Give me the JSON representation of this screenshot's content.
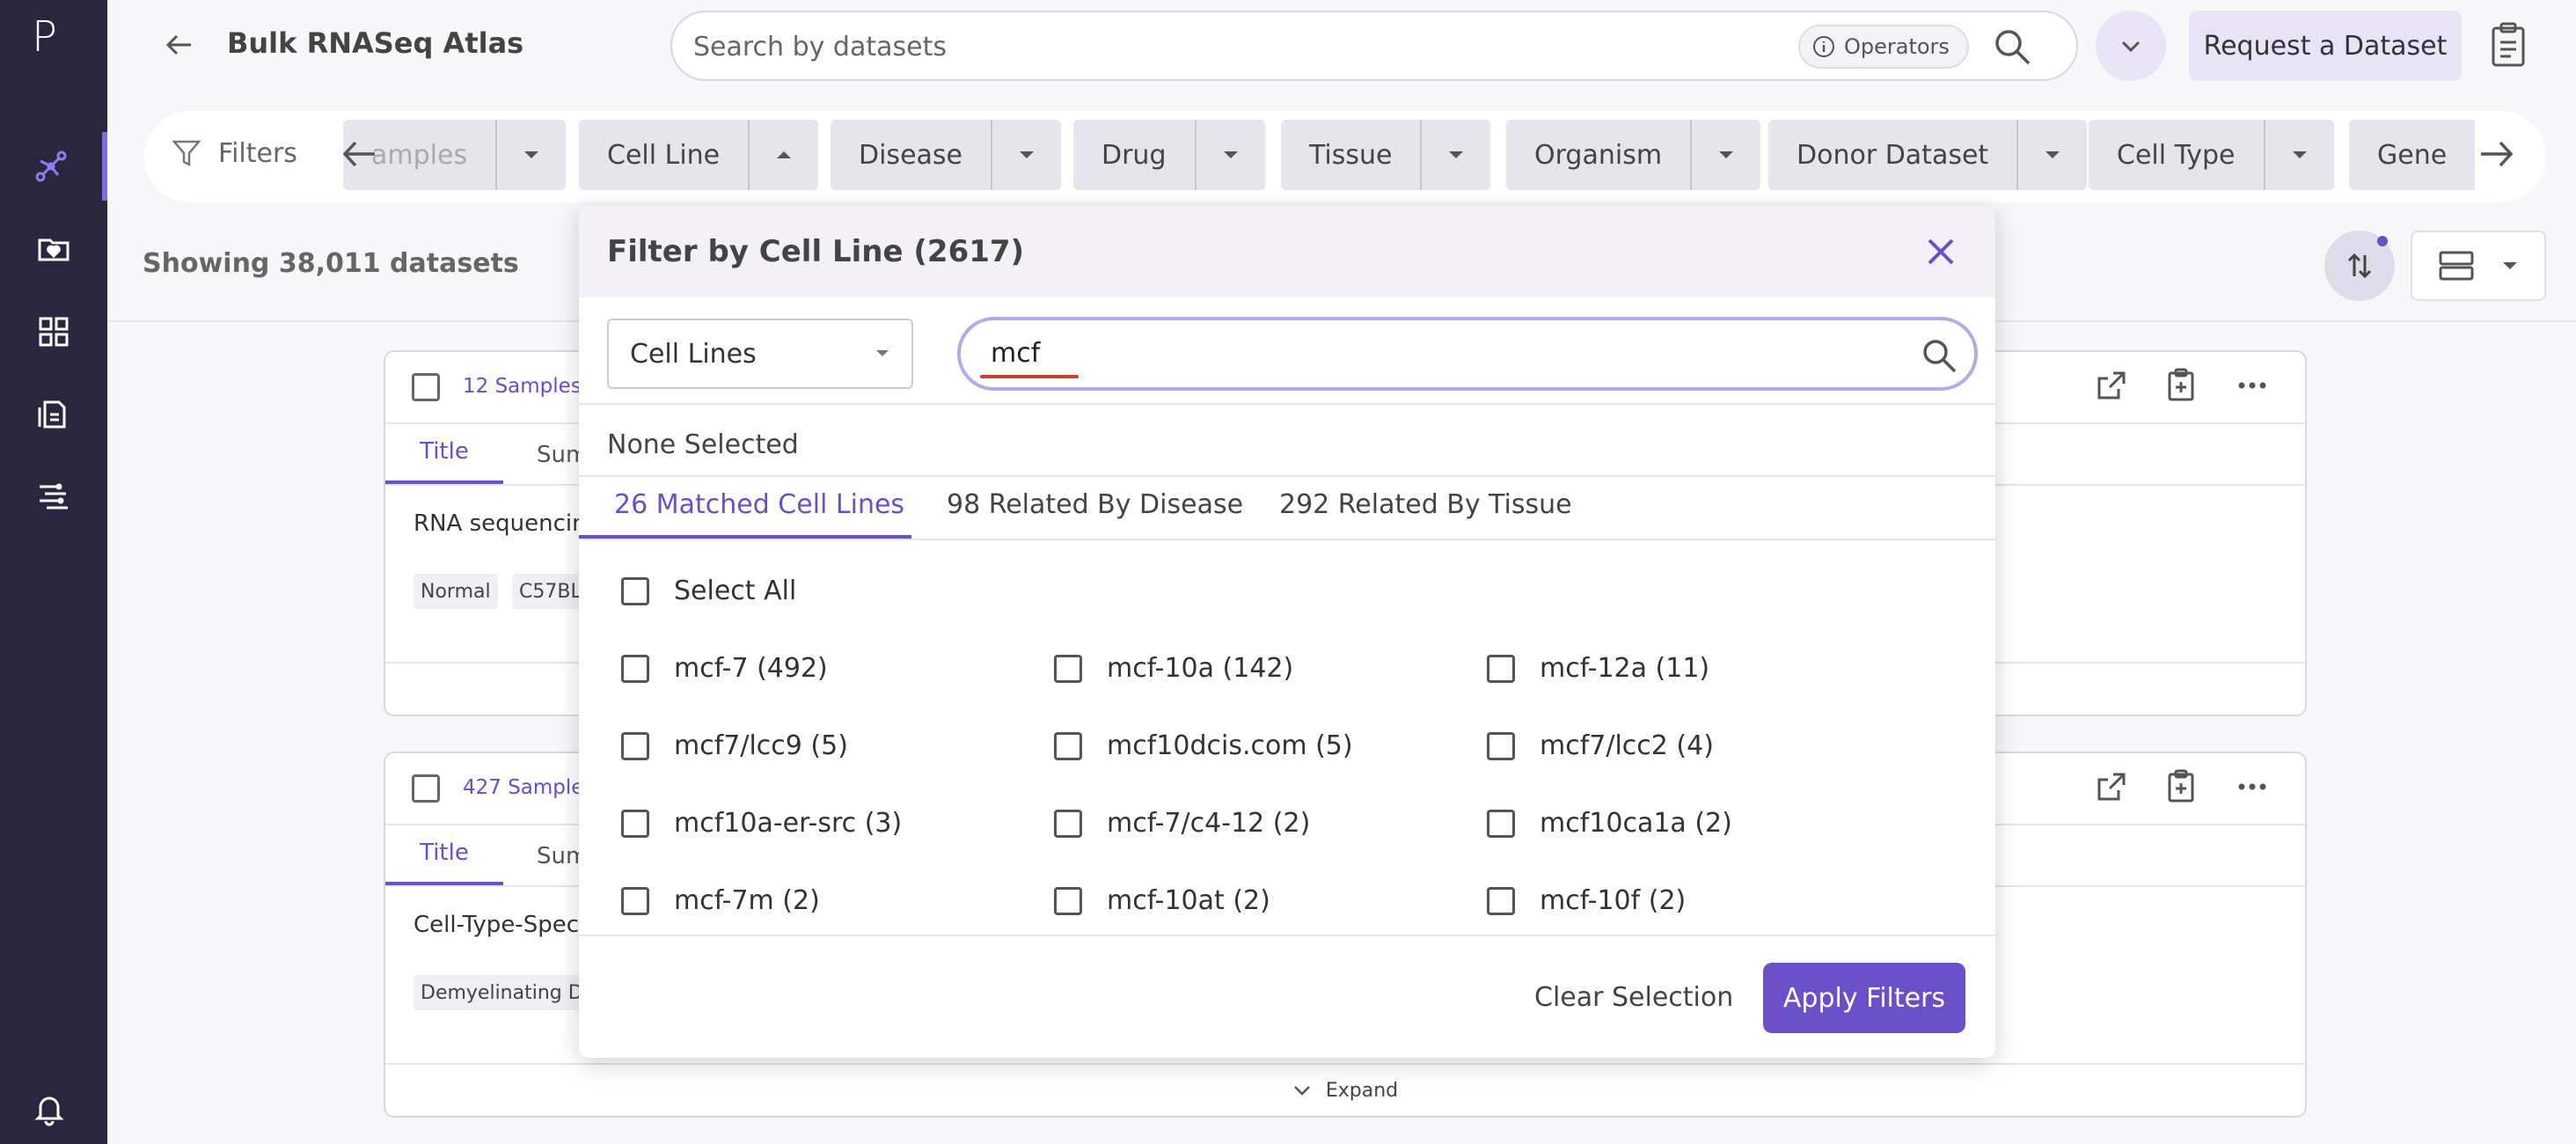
{
  "sidebar": {
    "logo": "P",
    "items": [
      {
        "icon": "atlas-network-icon"
      },
      {
        "icon": "folder-heart-icon"
      },
      {
        "icon": "grid-apps-icon"
      },
      {
        "icon": "document-clipboard-icon"
      },
      {
        "icon": "pipeline-icon"
      }
    ],
    "bottom_icon": "bell-icon"
  },
  "topbar": {
    "title": "Bulk RNASeq Atlas",
    "search_placeholder": "Search by datasets",
    "operators_label": "Operators",
    "request_button": "Request a Dataset"
  },
  "filterbar": {
    "label": "Filters",
    "chips": [
      {
        "label": "amples",
        "expanded": false
      },
      {
        "label": "Cell Line",
        "expanded": true
      },
      {
        "label": "Disease",
        "expanded": false
      },
      {
        "label": "Drug",
        "expanded": false
      },
      {
        "label": "Tissue",
        "expanded": false
      },
      {
        "label": "Organism",
        "expanded": false
      },
      {
        "label": "Donor Dataset",
        "expanded": false
      },
      {
        "label": "Cell Type",
        "expanded": false
      },
      {
        "label": "Gene",
        "expanded": false
      }
    ]
  },
  "results": {
    "showing": "Showing 38,011 datasets"
  },
  "cards": [
    {
      "samples": "12 Samples",
      "tab_title": "Title",
      "tab_summary": "Sum",
      "description": "RNA sequencing",
      "tags": [
        "Normal",
        "C57BL"
      ],
      "footer": ""
    },
    {
      "samples": "427 Samples",
      "tab_title": "Title",
      "tab_summary": "Sum",
      "description": "Cell-Type-Specifi",
      "tags": [
        "Demyelinating D"
      ],
      "footer": "Expand"
    }
  ],
  "modal": {
    "title": "Filter by Cell Line (2617)",
    "select_value": "Cell Lines",
    "search_value": "mcf",
    "none_selected": "None Selected",
    "tabs": [
      "26 Matched Cell Lines",
      "98 Related By Disease",
      "292 Related By Tissue"
    ],
    "active_tab": 0,
    "select_all": "Select All",
    "options": [
      "mcf-7 (492)",
      "mcf-10a (142)",
      "mcf-12a (11)",
      "mcf7/lcc9 (5)",
      "mcf10dcis.com (5)",
      "mcf7/lcc2 (4)",
      "mcf10a-er-src (3)",
      "mcf-7/c4-12 (2)",
      "mcf10ca1a (2)",
      "mcf-7m (2)",
      "mcf-10at (2)",
      "mcf-10f (2)"
    ],
    "clear_button": "Clear Selection",
    "apply_button": "Apply Filters"
  },
  "colors": {
    "sidebar_bg": "#2a2640",
    "accent": "#6a4fc8",
    "chip_bg": "#e6e4ec"
  }
}
